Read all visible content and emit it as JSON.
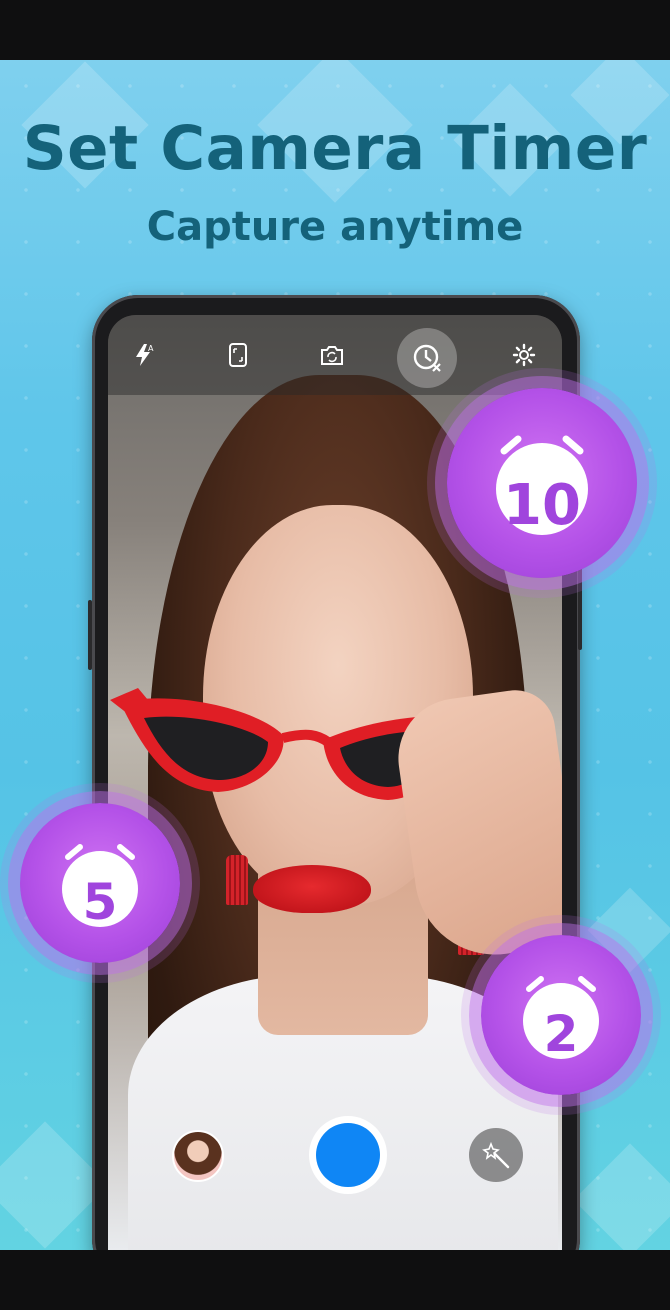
{
  "promo": {
    "title": "Set Camera Timer",
    "subtitle": "Capture anytime"
  },
  "camera_toolbar": {
    "icons": [
      "flash-auto-icon",
      "aspect-ratio-icon",
      "switch-camera-icon",
      "timer-icon",
      "settings-icon"
    ],
    "active": "timer-icon"
  },
  "timer_options": {
    "ten": "10",
    "five": "5",
    "two": "2"
  },
  "bottom_controls": {
    "gallery": "gallery-thumbnail",
    "shutter": "shutter-button",
    "effects": "magic-wand-icon"
  },
  "colors": {
    "background": "#5fc6ea",
    "title": "#14627a",
    "badge": "#b452e8",
    "shutter": "#0f86f5",
    "glasses": "#e01e25"
  }
}
